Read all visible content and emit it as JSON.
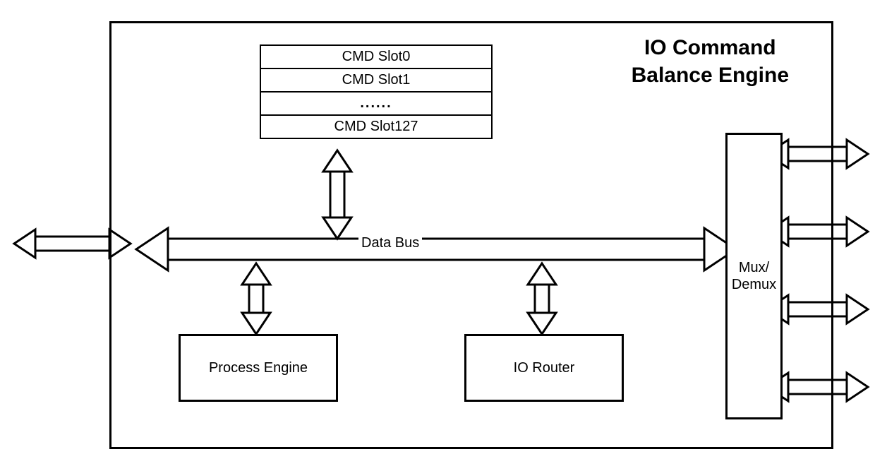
{
  "title_line1": "IO Command",
  "title_line2": "Balance Engine",
  "slots": {
    "s0": "CMD Slot0",
    "s1": "CMD Slot1",
    "ellipsis": "......",
    "sLast": "CMD Slot127"
  },
  "bus_label": "Data Bus",
  "process_engine": "Process Engine",
  "io_router": "IO Router",
  "mux_line1": "Mux/",
  "mux_line2": "Demux"
}
